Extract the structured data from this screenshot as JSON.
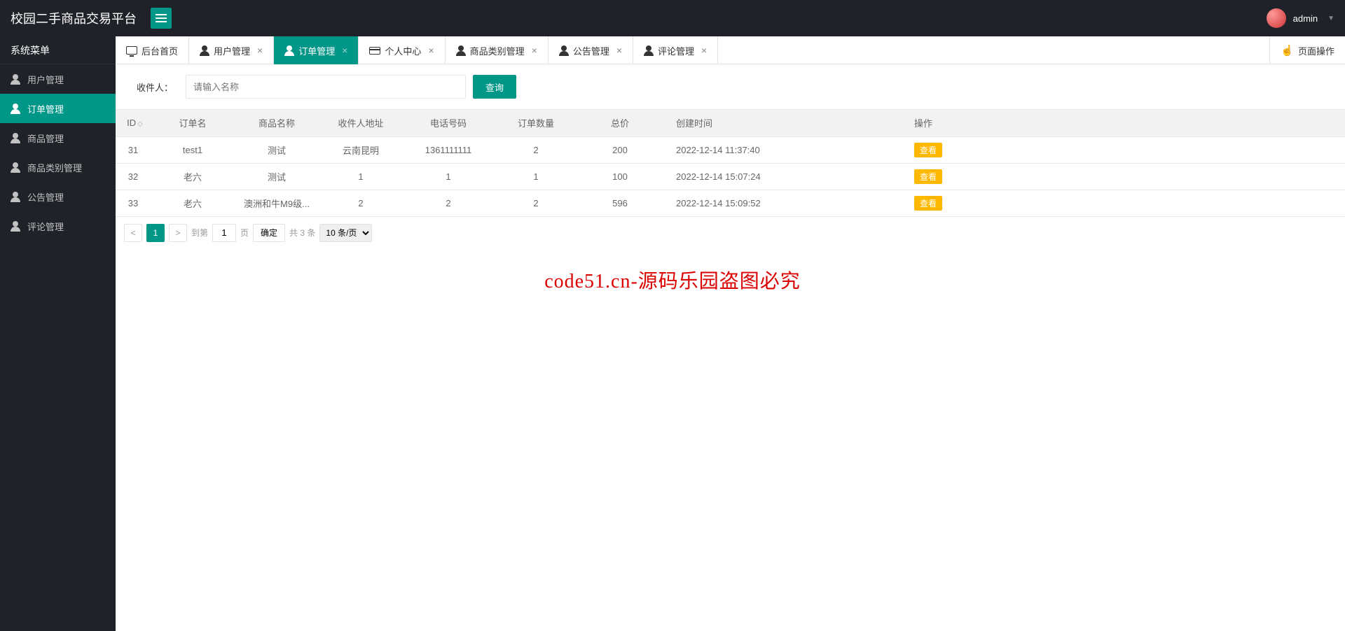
{
  "header": {
    "title": "校园二手商品交易平台",
    "username": "admin"
  },
  "sidebar": {
    "header": "系统菜单",
    "items": [
      {
        "label": "用户管理"
      },
      {
        "label": "订单管理"
      },
      {
        "label": "商品管理"
      },
      {
        "label": "商品类别管理"
      },
      {
        "label": "公告管理"
      },
      {
        "label": "评论管理"
      }
    ]
  },
  "tabs": [
    {
      "label": "后台首页",
      "icon": "monitor",
      "closable": false
    },
    {
      "label": "用户管理",
      "icon": "user",
      "closable": true
    },
    {
      "label": "订单管理",
      "icon": "user",
      "closable": true,
      "active": true
    },
    {
      "label": "个人中心",
      "icon": "card",
      "closable": true
    },
    {
      "label": "商品类别管理",
      "icon": "user",
      "closable": true
    },
    {
      "label": "公告管理",
      "icon": "user",
      "closable": true
    },
    {
      "label": "评论管理",
      "icon": "user",
      "closable": true
    }
  ],
  "pageOps": "页面操作",
  "search": {
    "label": "收件人：",
    "placeholder": "请输入名称",
    "button": "查询"
  },
  "table": {
    "headers": [
      "ID",
      "订单名",
      "商品名称",
      "收件人地址",
      "电话号码",
      "订单数量",
      "总价",
      "创建时间",
      "操作"
    ],
    "rows": [
      {
        "id": "31",
        "name": "test1",
        "product": "测试",
        "addr": "云南昆明",
        "phone": "1361111111",
        "qty": "2",
        "price": "200",
        "time": "2022-12-14 11:37:40",
        "action": "查看"
      },
      {
        "id": "32",
        "name": "老六",
        "product": "测试",
        "addr": "1",
        "phone": "1",
        "qty": "1",
        "price": "100",
        "time": "2022-12-14 15:07:24",
        "action": "查看"
      },
      {
        "id": "33",
        "name": "老六",
        "product": "澳洲和牛M9级...",
        "addr": "2",
        "phone": "2",
        "qty": "2",
        "price": "596",
        "time": "2022-12-14 15:09:52",
        "action": "查看"
      }
    ]
  },
  "pagination": {
    "current": "1",
    "gotoLabel": "到第",
    "pageLabel": "页",
    "gotoValue": "1",
    "confirm": "确定",
    "total": "共 3 条",
    "perPage": "10 条/页"
  },
  "watermark": "code51.cn-源码乐园盗图必究"
}
